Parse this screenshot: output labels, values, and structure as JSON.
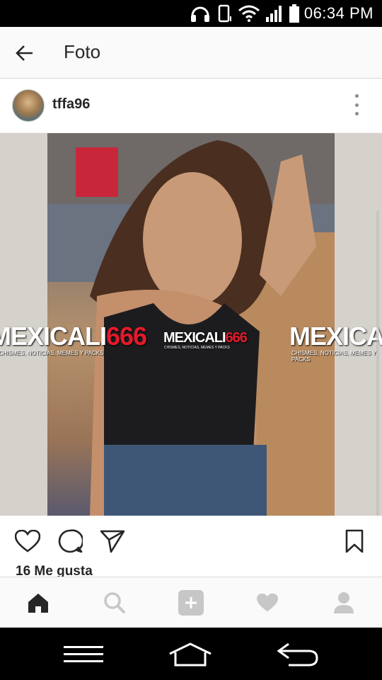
{
  "status_bar": {
    "time": "06:34 PM",
    "icons": [
      "headset-icon",
      "vibrate-icon",
      "wifi-icon",
      "signal-icon",
      "battery-icon"
    ]
  },
  "app_bar": {
    "back_icon": "arrow-left-icon",
    "title": "Foto"
  },
  "post": {
    "username": "tffa96",
    "more_icon": "more-vertical-icon",
    "watermark": {
      "brand_part1": "MEXICALI",
      "brand_part2": "666",
      "tagline": "CHISMES, NOTICIAS, MEMES Y PACKS",
      "brand_color": "#e21b2b"
    },
    "actions": [
      "heart-icon",
      "comment-icon",
      "share-icon",
      "bookmark-icon"
    ],
    "likes_text": "16 Me gusta"
  },
  "tab_bar": {
    "items": [
      "home-icon",
      "search-icon",
      "add-icon",
      "activity-heart-icon",
      "profile-icon"
    ],
    "active": "home-icon"
  },
  "nav_bar": {
    "items": [
      "recent-apps-icon",
      "home-nav-icon",
      "back-nav-icon"
    ]
  },
  "colors": {
    "accent_text": "#262626",
    "inactive_icon": "#c7c7c7"
  }
}
